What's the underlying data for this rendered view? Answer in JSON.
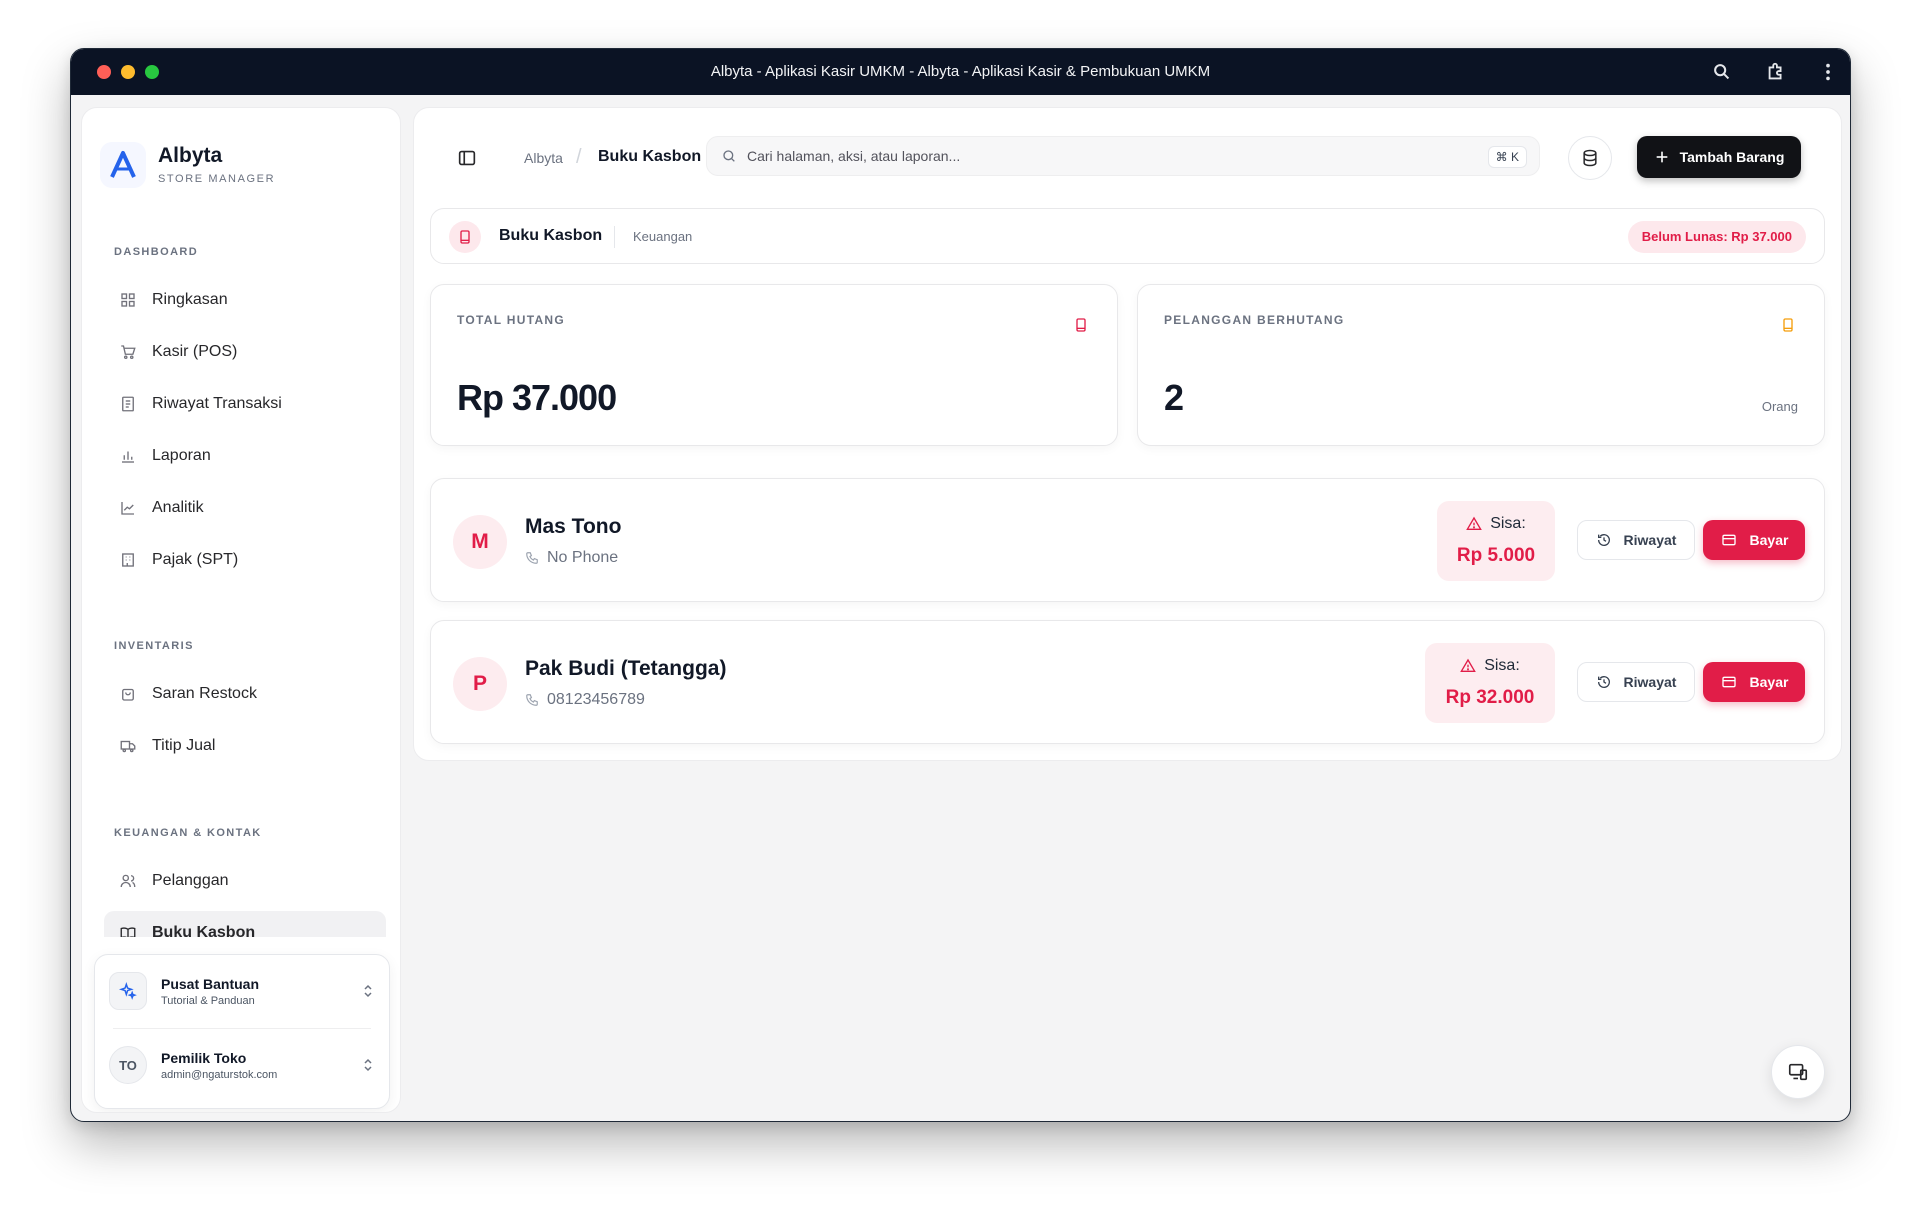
{
  "window": {
    "title": "Albyta - Aplikasi Kasir UMKM - Albyta - Aplikasi Kasir & Pembukuan UMKM"
  },
  "brand": {
    "name": "Albyta",
    "subtitle": "STORE MANAGER"
  },
  "sidebar": {
    "sections": [
      {
        "title": "DASHBOARD",
        "items": [
          {
            "label": "Ringkasan",
            "icon": "grid-icon"
          },
          {
            "label": "Kasir (POS)",
            "icon": "cart-icon"
          },
          {
            "label": "Riwayat Transaksi",
            "icon": "receipt-icon"
          },
          {
            "label": "Laporan",
            "icon": "bar-chart-icon"
          },
          {
            "label": "Analitik",
            "icon": "line-chart-icon"
          },
          {
            "label": "Pajak (SPT)",
            "icon": "building-icon"
          }
        ]
      },
      {
        "title": "INVENTARIS",
        "items": [
          {
            "label": "Saran Restock",
            "icon": "bag-icon"
          },
          {
            "label": "Titip Jual",
            "icon": "truck-icon"
          }
        ]
      },
      {
        "title": "KEUANGAN & KONTAK",
        "items": [
          {
            "label": "Pelanggan",
            "icon": "users-icon"
          },
          {
            "label": "Buku Kasbon",
            "icon": "book-icon",
            "active": true
          }
        ]
      }
    ],
    "footer": {
      "help": {
        "title": "Pusat Bantuan",
        "subtitle": "Tutorial & Panduan"
      },
      "user": {
        "initials": "TO",
        "name": "Pemilik Toko",
        "email": "admin@ngaturstok.com"
      }
    }
  },
  "topbar": {
    "breadcrumb": [
      "Albyta",
      "Buku Kasbon"
    ],
    "search": {
      "placeholder": "Cari halaman, aksi, atau laporan...",
      "shortcut": "⌘ K"
    },
    "add_button": "Tambah Barang"
  },
  "page_header": {
    "title": "Buku Kasbon",
    "category": "Keuangan",
    "badge": "Belum Lunas: Rp 37.000"
  },
  "stats": [
    {
      "label": "TOTAL HUTANG",
      "value": "Rp 37.000",
      "unit": "",
      "icon_color": "#e11d48"
    },
    {
      "label": "PELANGGAN BERHUTANG",
      "value": "2",
      "unit": "Orang",
      "icon_color": "#f59e0b"
    }
  ],
  "debtors": [
    {
      "initial": "M",
      "name": "Mas Tono",
      "phone": "No Phone",
      "sisa_label": "Sisa:",
      "sisa_value": "Rp 5.000",
      "history_label": "Riwayat",
      "pay_label": "Bayar"
    },
    {
      "initial": "P",
      "name": "Pak Budi (Tetangga)",
      "phone": "08123456789",
      "sisa_label": "Sisa:",
      "sisa_value": "Rp 32.000",
      "history_label": "Riwayat",
      "pay_label": "Bayar"
    }
  ],
  "colors": {
    "accent": "#e11d48",
    "dark": "#111216",
    "titlebar": "#0b1324"
  }
}
